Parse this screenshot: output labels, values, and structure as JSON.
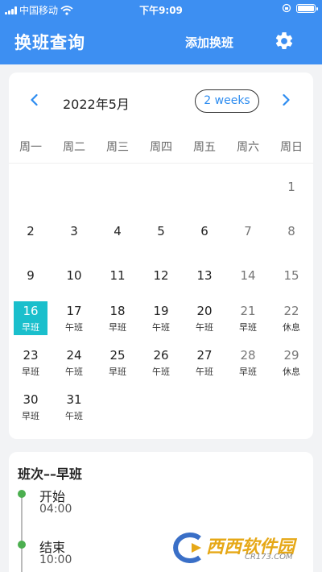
{
  "status_bar": {
    "carrier": "中国移动",
    "time": "下午9:09"
  },
  "app_bar": {
    "title": "换班查询",
    "add_label": "添加换班",
    "settings_icon": "gear-icon",
    "color": "#3d8ff2"
  },
  "calendar": {
    "month_label": "2022年5月",
    "view_toggle": "2 weeks",
    "weekdays": [
      "周一",
      "周二",
      "周三",
      "周四",
      "周五",
      "周六",
      "周日"
    ],
    "leading_blanks": 6,
    "days": [
      {
        "d": "1",
        "s": ""
      },
      {
        "d": "2",
        "s": ""
      },
      {
        "d": "3",
        "s": ""
      },
      {
        "d": "4",
        "s": ""
      },
      {
        "d": "5",
        "s": ""
      },
      {
        "d": "6",
        "s": ""
      },
      {
        "d": "7",
        "s": ""
      },
      {
        "d": "8",
        "s": ""
      },
      {
        "d": "9",
        "s": ""
      },
      {
        "d": "10",
        "s": ""
      },
      {
        "d": "11",
        "s": ""
      },
      {
        "d": "12",
        "s": ""
      },
      {
        "d": "13",
        "s": ""
      },
      {
        "d": "14",
        "s": ""
      },
      {
        "d": "15",
        "s": ""
      },
      {
        "d": "16",
        "s": "早班",
        "today": true
      },
      {
        "d": "17",
        "s": "午班"
      },
      {
        "d": "18",
        "s": "早班"
      },
      {
        "d": "19",
        "s": "午班"
      },
      {
        "d": "20",
        "s": "午班"
      },
      {
        "d": "21",
        "s": "早班"
      },
      {
        "d": "22",
        "s": "休息"
      },
      {
        "d": "23",
        "s": "早班"
      },
      {
        "d": "24",
        "s": "午班"
      },
      {
        "d": "25",
        "s": "早班"
      },
      {
        "d": "26",
        "s": "午班"
      },
      {
        "d": "27",
        "s": "午班"
      },
      {
        "d": "28",
        "s": "早班"
      },
      {
        "d": "29",
        "s": "休息"
      },
      {
        "d": "30",
        "s": "早班"
      },
      {
        "d": "31",
        "s": "午班"
      }
    ],
    "highlight_color": "#1abfcc"
  },
  "detail": {
    "title": "班次––早班",
    "events": [
      {
        "label": "开始",
        "time": "04:00"
      },
      {
        "label": "结束",
        "time": "10:00"
      }
    ],
    "dot_color": "#4caf50"
  },
  "watermark": {
    "text": "西西软件园",
    "sub": "CR173.COM"
  }
}
